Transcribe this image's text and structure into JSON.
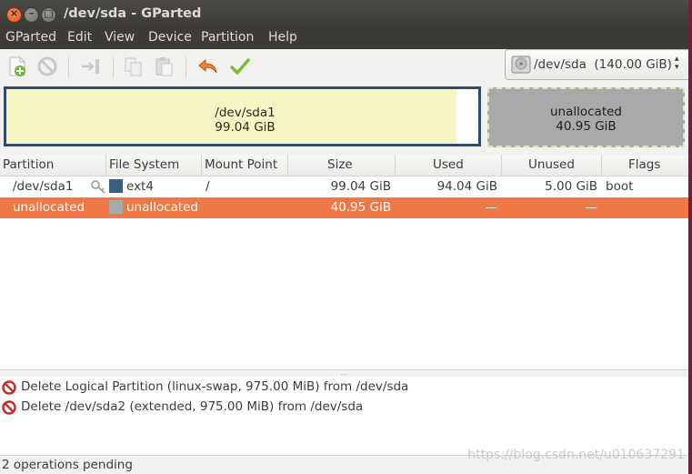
{
  "window": {
    "title": "/dev/sda - GParted"
  },
  "menu": [
    "GParted",
    "Edit",
    "View",
    "Device",
    "Partition",
    "Help"
  ],
  "toolbar": {
    "buttons": [
      "new-partition-icon",
      "delete-icon",
      "resize-move-icon",
      "copy-icon",
      "paste-icon",
      "undo-icon",
      "apply-icon"
    ]
  },
  "device_selector": {
    "device": "/dev/sda",
    "size": "(140.00 GiB)",
    "label": "/dev/sda  (140.00 GiB)"
  },
  "disk_map": {
    "partitions": [
      {
        "name": "/dev/sda1",
        "size": "99.04 GiB",
        "used_fraction": 0.95
      },
      {
        "name": "unallocated",
        "size": "40.95 GiB"
      }
    ]
  },
  "table": {
    "columns": [
      "Partition",
      "File System",
      "Mount Point",
      "Size",
      "Used",
      "Unused",
      "Flags"
    ],
    "rows": [
      {
        "partition": "/dev/sda1",
        "filesystem": "ext4",
        "fs_color": "#3b5e82",
        "mount": "/",
        "size": "99.04 GiB",
        "used": "94.04 GiB",
        "unused": "5.00 GiB",
        "flags": "boot",
        "selected": false
      },
      {
        "partition": "unallocated",
        "filesystem": "unallocated",
        "fs_color": "#a9a9a9",
        "mount": "",
        "size": "40.95 GiB",
        "used": "—",
        "unused": "—",
        "flags": "",
        "selected": true
      }
    ]
  },
  "operations": [
    "Delete Logical Partition (linux-swap, 975.00 MiB) from /dev/sda",
    "Delete /dev/sda2 (extended, 975.00 MiB) from /dev/sda"
  ],
  "status": "2 operations pending",
  "watermark": "https://blog.csdn.net/u010637291",
  "colors": {
    "selection": "#f07746",
    "ext4": "#3b5e82",
    "unallocated": "#a9a9a9",
    "titlebar": "#3c3b37"
  }
}
